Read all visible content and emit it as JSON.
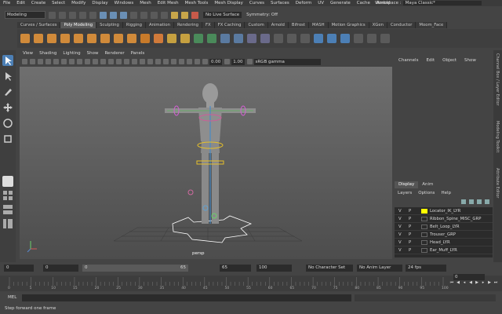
{
  "menubar": {
    "items": [
      "File",
      "Edit",
      "Create",
      "Select",
      "Modify",
      "Display",
      "Windows",
      "Mesh",
      "Edit Mesh",
      "Mesh Tools",
      "Mesh Display",
      "Curves",
      "Surfaces",
      "Deform",
      "UV",
      "Generate",
      "Cache",
      "Arnold"
    ],
    "workspace_label": "Workspace :",
    "workspace_value": "Maya Classic*"
  },
  "statusline": {
    "mode": "Modeling",
    "live_surface": "No Live Surface",
    "symmetry": "Symmetry: Off"
  },
  "shelf": {
    "tabs": [
      "Curves / Surfaces",
      "Poly Modeling",
      "Sculpting",
      "Rigging",
      "Animation",
      "Rendering",
      "FX",
      "FX Caching",
      "Custom",
      "Arnold",
      "Bifrost",
      "MASH",
      "Motion Graphics",
      "XGen",
      "Conductor",
      "Moom_Face"
    ],
    "active_tab": "Poly Modeling"
  },
  "viewport": {
    "menu": [
      "View",
      "Shading",
      "Lighting",
      "Show",
      "Renderer",
      "Panels"
    ],
    "value_a": "0.00",
    "value_b": "1.00",
    "color_space": "sRGB gamma",
    "camera_label": "persp"
  },
  "channel_box": {
    "menu": [
      "Channels",
      "Edit",
      "Object",
      "Show"
    ]
  },
  "side_tabs": [
    "Channel Box / Layer Editor",
    "Modeling Toolkit",
    "Attribute Editor"
  ],
  "layer_editor": {
    "tabs": [
      "Display",
      "Anim"
    ],
    "menu": [
      "Layers",
      "Options",
      "Help"
    ],
    "layers": [
      {
        "v": "V",
        "p": "P",
        "name": "Locator_IK_LYR",
        "color": "#ffff00"
      },
      {
        "v": "V",
        "p": "P",
        "name": "Ribbon_Spine_MISC_GRP",
        "color": ""
      },
      {
        "v": "V",
        "p": "P",
        "name": "Belt_Loop_LYR",
        "color": ""
      },
      {
        "v": "V",
        "p": "P",
        "name": "Trouser_GRP",
        "color": ""
      },
      {
        "v": "V",
        "p": "P",
        "name": "Head_LYR",
        "color": ""
      },
      {
        "v": "V",
        "p": "P",
        "name": "Ear_Muff_LYR",
        "color": ""
      }
    ]
  },
  "timeline": {
    "ticks": [
      "0",
      "5",
      "10",
      "15",
      "20",
      "25",
      "30",
      "35",
      "40",
      "45",
      "50",
      "55",
      "60",
      "65",
      "70",
      "75",
      "80",
      "85",
      "90",
      "95",
      "100"
    ],
    "current_frame": "0",
    "range_start": "0",
    "range_inner_start": "0",
    "range_inner_end": "65",
    "range_end": "65",
    "anim_end": "100",
    "character_set": "No Character Set",
    "anim_layer": "No Anim Layer",
    "fps": "24 fps"
  },
  "command_line": {
    "label": "MEL"
  },
  "help_line": {
    "text": "Step forward one frame"
  }
}
